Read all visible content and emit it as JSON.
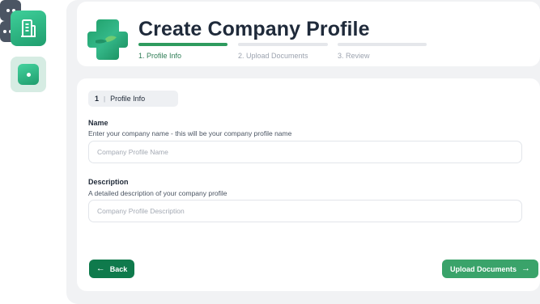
{
  "header": {
    "title": "Create Company Profile",
    "steps": [
      {
        "label": "1. Profile Info",
        "state": "active"
      },
      {
        "label": "2. Upload Documents",
        "state": "pending"
      },
      {
        "label": "3. Review",
        "state": "pending"
      }
    ]
  },
  "sidebar": {
    "items": [
      {
        "icon": "building-icon",
        "state": "logo"
      },
      {
        "icon": "dot-icon",
        "state": "active"
      },
      {
        "icon": "two-dots-icon",
        "state": "default"
      },
      {
        "icon": "three-dots-icon",
        "state": "default"
      }
    ]
  },
  "form": {
    "section": {
      "number": "1",
      "separator": "|",
      "label": "Profile Info"
    },
    "name": {
      "label": "Name",
      "help": "Enter your company name - this will be your company profile name",
      "placeholder": "Company Profile Name",
      "value": ""
    },
    "description": {
      "label": "Description",
      "help": "A detailed description of your company profile",
      "placeholder": "Company Profile Description",
      "value": ""
    }
  },
  "actions": {
    "back_label": "Back",
    "back_icon": "arrow-left-icon",
    "next_label": "Upload Documents",
    "next_icon": "arrow-right-icon"
  },
  "colors": {
    "brand_green": "#2e9b5e",
    "dark_green": "#0f7a4c",
    "button_green": "#3aa36a",
    "inactive_bar": "#e5e7eb"
  }
}
